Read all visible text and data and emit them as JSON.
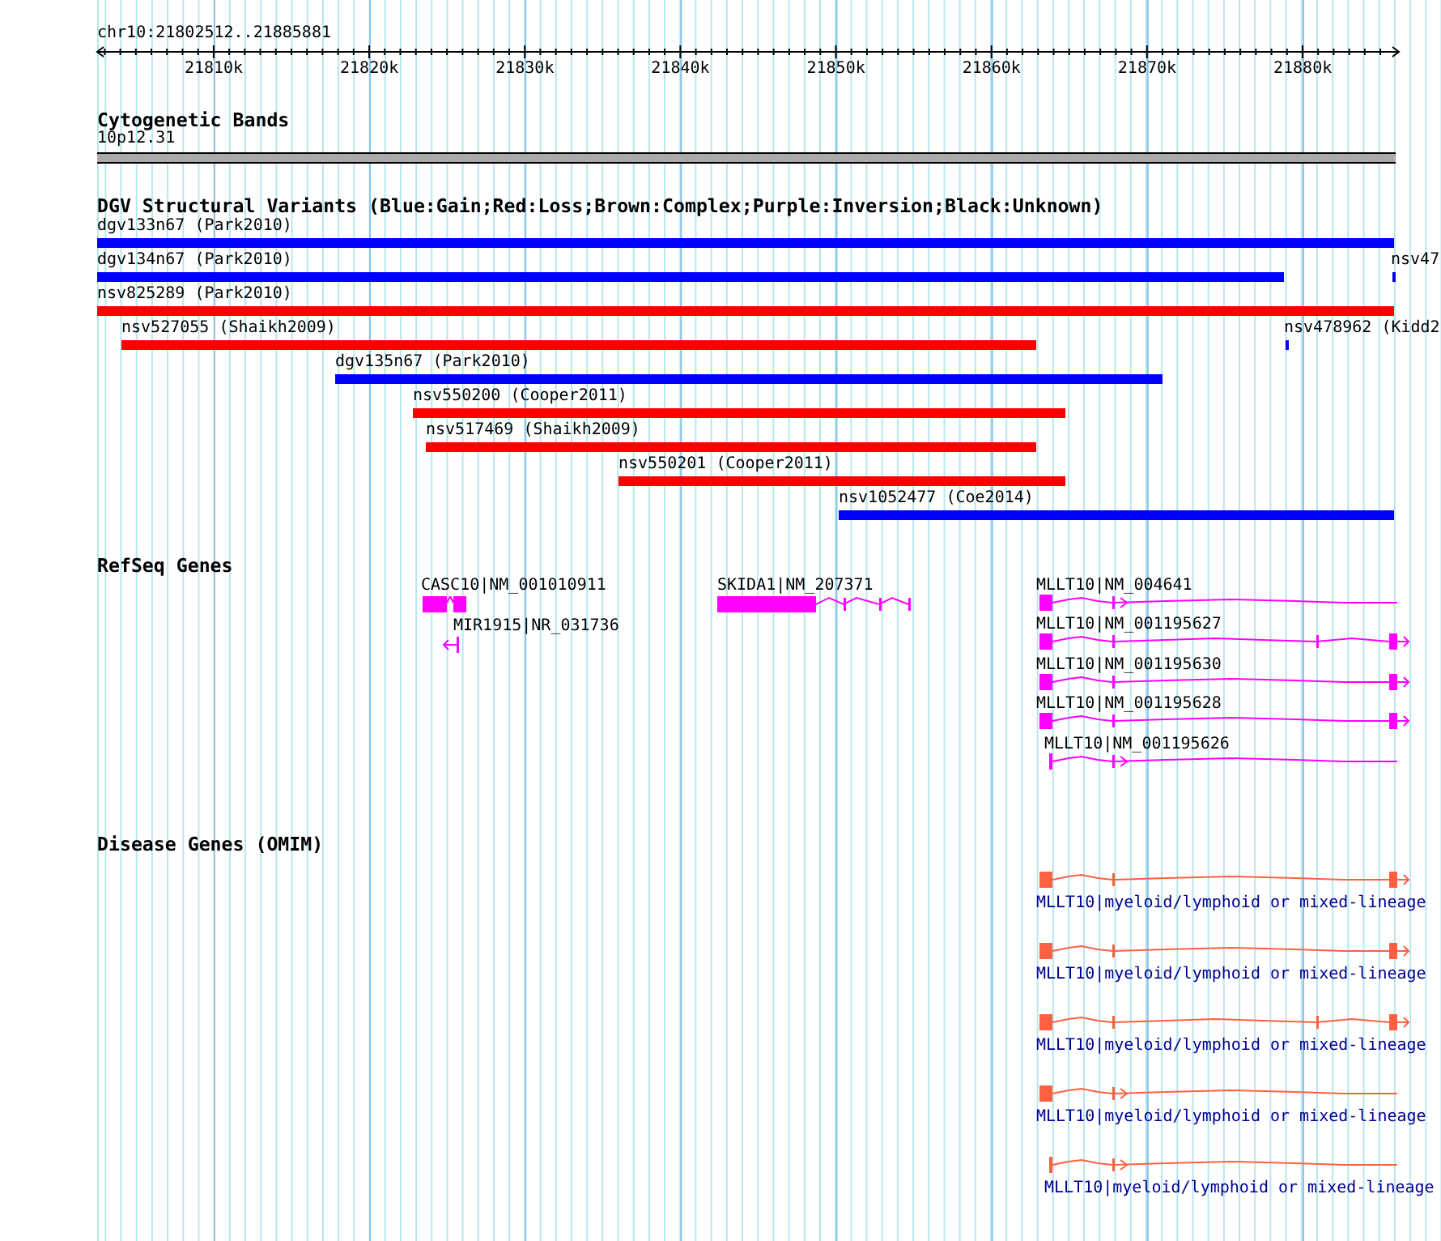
{
  "ruler": {
    "location": "chr10:21802512..21885881",
    "ticks": [
      "21810k",
      "21820k",
      "21830k",
      "21840k",
      "21850k",
      "21860k",
      "21870k",
      "21880k"
    ]
  },
  "cytoband": {
    "title": "Cytogenetic Bands",
    "band": "10p12.31"
  },
  "variants": {
    "title": "DGV Structural Variants (Blue:Gain;Red:Loss;Brown:Complex;Purple:Inversion;Black:Unknown)",
    "features": [
      {
        "label": "dgv133n67 (Park2010)",
        "color": "#0000ff"
      },
      {
        "label": "dgv134n67 (Park2010)",
        "color": "#0000ff"
      },
      {
        "label": "nsv47",
        "color": "#0000ff"
      },
      {
        "label": "nsv825289 (Park2010)",
        "color": "#ff0000"
      },
      {
        "label": "nsv527055 (Shaikh2009)",
        "color": "#ff0000"
      },
      {
        "label": "nsv478962 (Kidd2",
        "color": "#0000ff"
      },
      {
        "label": "dgv135n67 (Park2010)",
        "color": "#0000ff"
      },
      {
        "label": "nsv550200 (Cooper2011)",
        "color": "#ff0000"
      },
      {
        "label": "nsv517469 (Shaikh2009)",
        "color": "#ff0000"
      },
      {
        "label": "nsv550201 (Cooper2011)",
        "color": "#ff0000"
      },
      {
        "label": "nsv1052477 (Coe2014)",
        "color": "#0000ff"
      }
    ]
  },
  "genes": {
    "title": "RefSeq Genes",
    "features": [
      {
        "label": "CASC10|NM_001010911"
      },
      {
        "label": "MIR1915|NR_031736"
      },
      {
        "label": "SKIDA1|NM_207371"
      },
      {
        "label": "MLLT10|NM_004641"
      },
      {
        "label": "MLLT10|NM_001195627"
      },
      {
        "label": "MLLT10|NM_001195630"
      },
      {
        "label": "MLLT10|NM_001195628"
      },
      {
        "label": "MLLT10|NM_001195626"
      }
    ]
  },
  "disease": {
    "title": "Disease Genes (OMIM)",
    "features": [
      {
        "label": "MLLT10|myeloid/lymphoid or mixed-lineage"
      },
      {
        "label": "MLLT10|myeloid/lymphoid or mixed-lineage"
      },
      {
        "label": "MLLT10|myeloid/lymphoid or mixed-lineage"
      },
      {
        "label": "MLLT10|myeloid/lymphoid or mixed-lineage"
      },
      {
        "label": "MLLT10|myeloid/lymphoid or mixed-lineage"
      }
    ]
  }
}
